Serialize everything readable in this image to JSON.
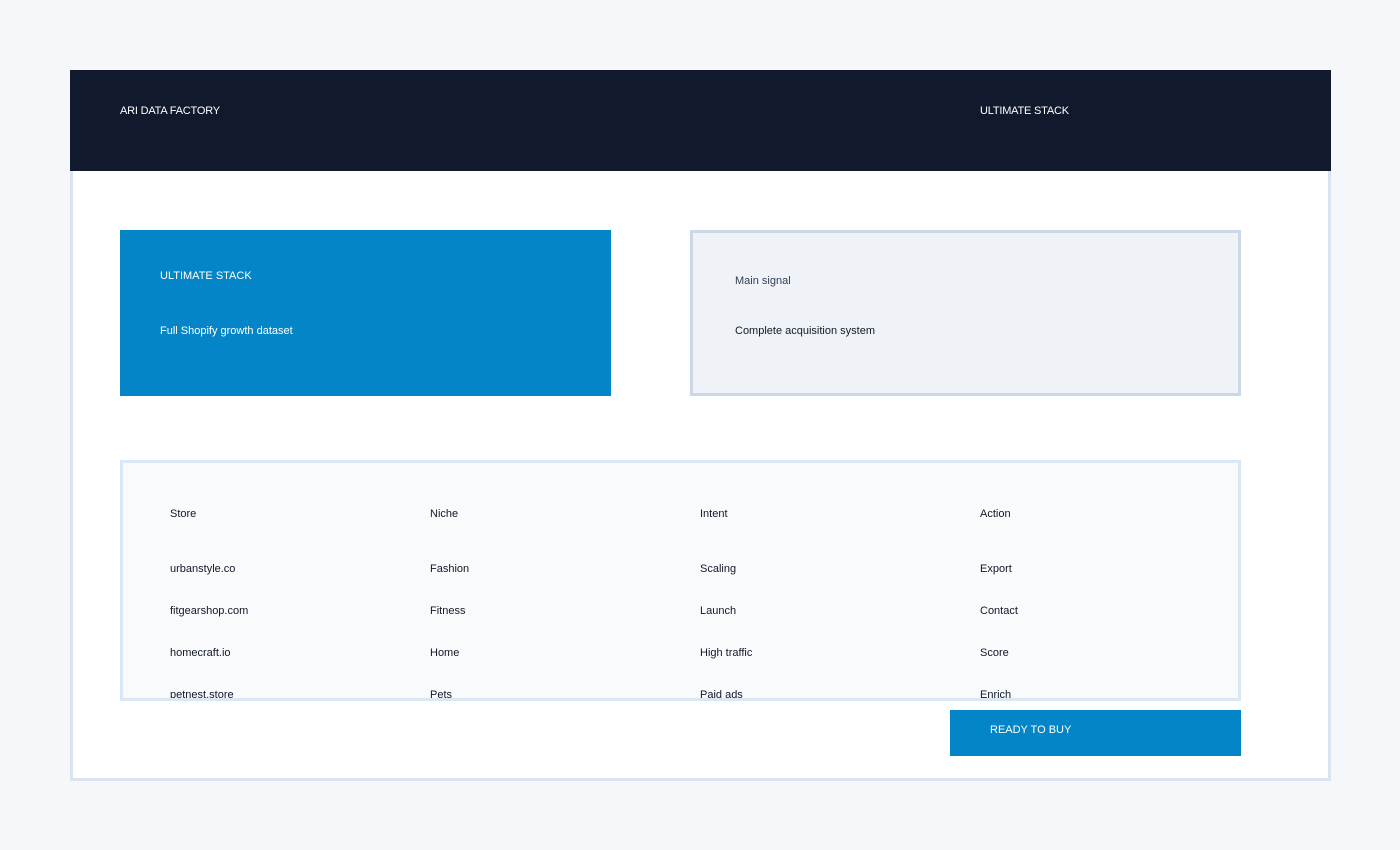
{
  "header": {
    "brand": "ARI DATA FACTORY",
    "plan": "ULTIMATE STACK"
  },
  "hero": {
    "kicker": "ULTIMATE STACK",
    "description": "Full Shopify growth dataset"
  },
  "signal": {
    "label": "Main signal",
    "value": "Complete acquisition system"
  },
  "table": {
    "columns": [
      "Store",
      "Niche",
      "Intent",
      "Action"
    ],
    "rows": [
      [
        "urbanstyle.co",
        "Fashion",
        "Scaling",
        "Export"
      ],
      [
        "fitgearshop.com",
        "Fitness",
        "Launch",
        "Contact"
      ],
      [
        "homecraft.io",
        "Home",
        "High traffic",
        "Score"
      ],
      [
        "petnest.store",
        "Pets",
        "Paid ads",
        "Enrich"
      ]
    ]
  },
  "cta": {
    "label": "READY TO BUY"
  },
  "colors": {
    "topbar": "#111a2c",
    "accent": "#0485c8",
    "page_background": "#f5f7fa"
  }
}
